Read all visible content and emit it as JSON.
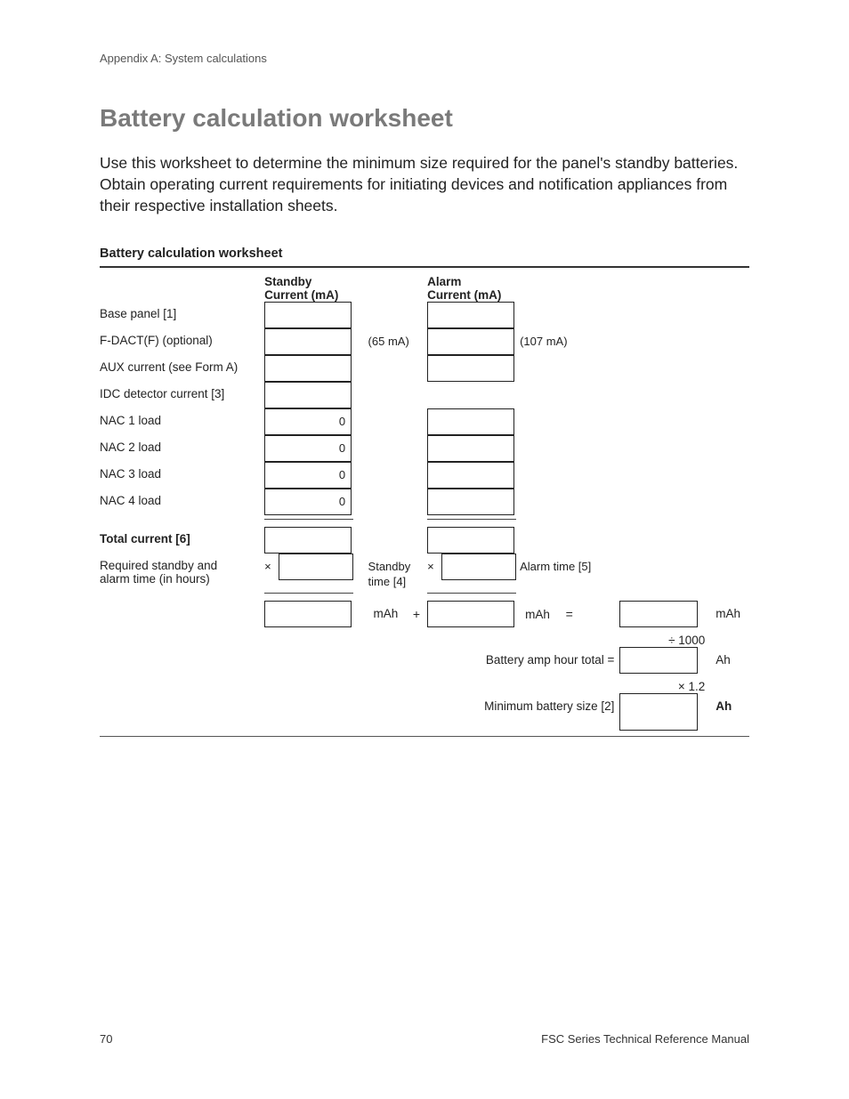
{
  "header": "Appendix A: System calculations",
  "title": "Battery calculation worksheet",
  "intro": "Use this worksheet to determine the minimum size required for the panel's standby batteries. Obtain operating current requirements for initiating devices and notification appliances from their respective installation sheets.",
  "table_title": "Battery calculation worksheet",
  "cols": {
    "standby": "Standby\nCurrent (mA)",
    "alarm": "Alarm\nCurrent (mA)"
  },
  "rows": {
    "base": "Base panel [1]",
    "fdact": "F-DACT(F) (optional)",
    "fdact_standby_note": "(65 mA)",
    "fdact_alarm_note": "(107 mA)",
    "aux": "AUX current (see Form A)",
    "idc": "IDC detector current [3]",
    "nac1": "NAC 1 load",
    "nac2": "NAC 2 load",
    "nac3": "NAC 3 load",
    "nac4": "NAC 4 load",
    "nac_val": "0",
    "total": "Total current [6]",
    "req1": "Required standby and",
    "req2": "alarm time (in hours)",
    "standby_time": "Standby time [4]",
    "alarm_time": "Alarm time [5]",
    "mult": "×",
    "plus": "+",
    "eq": "=",
    "mah": "mAh",
    "div1000": "÷ 1000",
    "amp_total": "Battery amp hour total =",
    "ah": "Ah",
    "mult12": "× 1.2",
    "min_size": "Minimum battery size [2]"
  },
  "footer": {
    "page": "70",
    "manual": "FSC Series Technical Reference Manual"
  }
}
